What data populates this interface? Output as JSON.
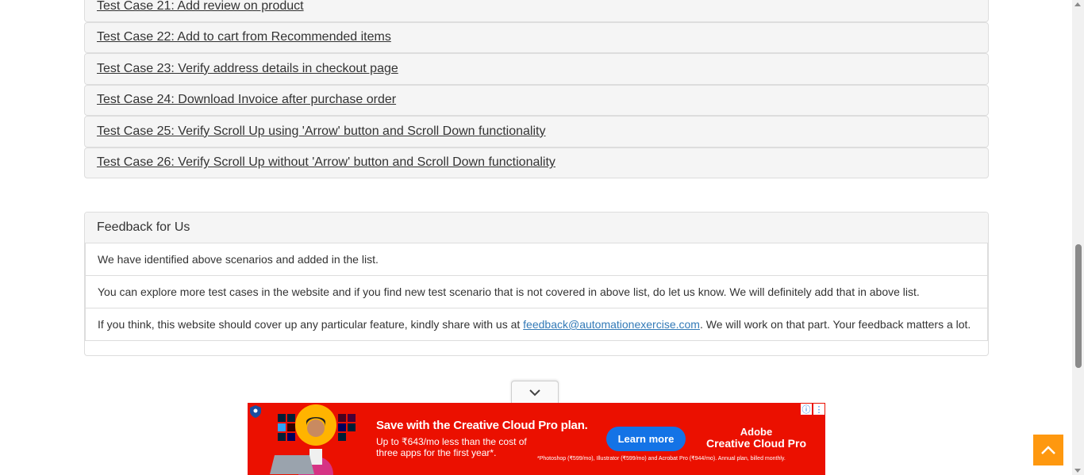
{
  "test_cases": [
    {
      "label": "Test Case 21: Add review on product"
    },
    {
      "label": "Test Case 22: Add to cart from Recommended items"
    },
    {
      "label": "Test Case 23: Verify address details in checkout page"
    },
    {
      "label": "Test Case 24: Download Invoice after purchase order"
    },
    {
      "label": "Test Case 25: Verify Scroll Up using 'Arrow' button and Scroll Down functionality"
    },
    {
      "label": "Test Case 26: Verify Scroll Up without 'Arrow' button and Scroll Down functionality"
    }
  ],
  "feedback": {
    "title": "Feedback for Us",
    "line1": "We have identified above scenarios and added in the list.",
    "line2": "You can explore more test cases in the website and if you find new test scenario that is not covered in above list, do let us know. We will definitely add that in above list.",
    "line3_prefix": "If you think, this website should cover up any particular feature, kindly share with us at ",
    "email": "feedback@automationexercise.com",
    "line3_suffix": ". We will work on that part. Your feedback matters a lot."
  },
  "ad": {
    "title": "Save with the Creative Cloud Pro plan.",
    "subtitle": "Up to ₹643/mo less than the cost of three apps for the first year*.",
    "button": "Learn more",
    "brand_line1": "Adobe",
    "brand_line2": "Creative Cloud Pro",
    "fine_print": "*Photoshop (₹599/mo), Illustrator (₹599/mo) and Acrobat Pro (₹944/mo). Annual plan, billed monthly.",
    "background_color": "#eb1000",
    "button_color": "#1473e6"
  },
  "icons": {
    "scroll_up": "chevron-up-icon",
    "ad_collapse": "chevron-down-icon",
    "ad_info": "info-icon",
    "ad_menu": "more-vert-icon"
  },
  "colors": {
    "scroll_up_button": "#fe980f",
    "link": "#337ab7",
    "panel_heading": "#f5f5f5"
  }
}
